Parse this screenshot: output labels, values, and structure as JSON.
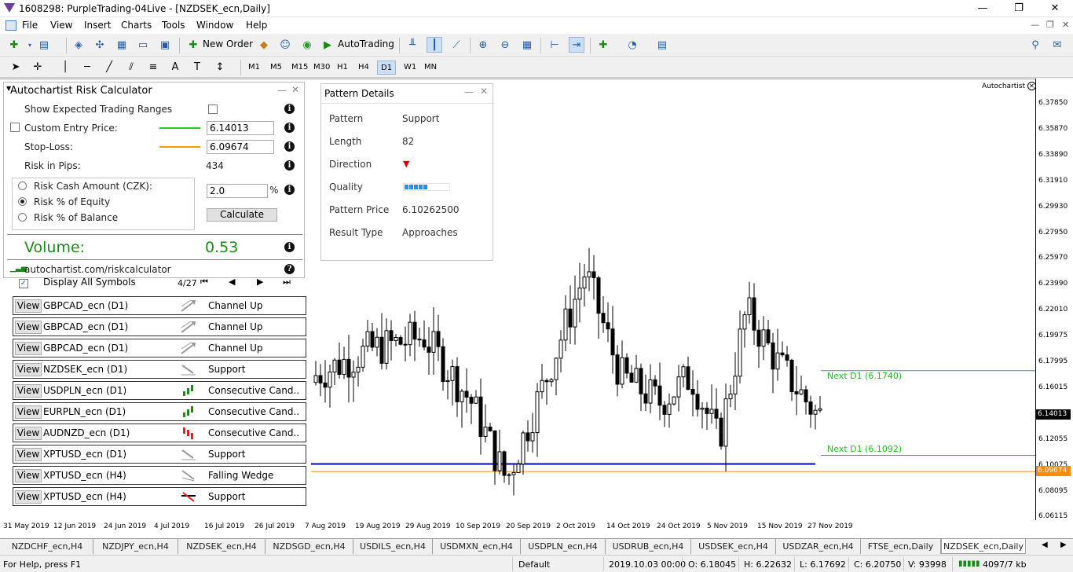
{
  "window": {
    "title": "1608298: PurpleTrading-04Live - [NZDSEK_ecn,Daily]"
  },
  "menu": [
    "File",
    "View",
    "Insert",
    "Charts",
    "Tools",
    "Window",
    "Help"
  ],
  "toolbar": {
    "new_order": "New Order",
    "autotrading": "AutoTrading"
  },
  "timeframes": [
    "M1",
    "M5",
    "M15",
    "M30",
    "H1",
    "H4",
    "D1",
    "W1",
    "MN"
  ],
  "active_timeframe": "D1",
  "chart": {
    "watermark": "Autochartist",
    "price_labels": [
      "6.37850",
      "6.35870",
      "6.33890",
      "6.31910",
      "6.29930",
      "6.27950",
      "6.25970",
      "6.23990",
      "6.22010",
      "6.19975",
      "6.17995",
      "6.16015",
      "6.14013",
      "6.12055",
      "6.10075",
      "6.09674",
      "6.08095",
      "6.06115"
    ],
    "current_price": "6.14013",
    "stop_price": "6.09674",
    "date_labels": [
      "31 May 2019",
      "12 Jun 2019",
      "24 Jun 2019",
      "4 Jul 2019",
      "16 Jul 2019",
      "26 Jul 2019",
      "7 Aug 2019",
      "19 Aug 2019",
      "29 Aug 2019",
      "10 Sep 2019",
      "20 Sep 2019",
      "2 Oct 2019",
      "14 Oct 2019",
      "24 Oct 2019",
      "5 Nov 2019",
      "15 Nov 2019",
      "27 Nov 2019"
    ],
    "next_up": "Next D1 (6.1740)",
    "next_down": "Next D1 (6.1092)",
    "colors": {
      "up": "#000000",
      "down": "#000000",
      "support": "#0000aa",
      "stop": "#ff8c00",
      "next": "#22bb22"
    }
  },
  "risk": {
    "title": "Autochartist Risk Calculator",
    "show_ranges": "Show Expected Trading Ranges",
    "custom_entry": "Custom Entry Price:",
    "entry_value": "6.14013",
    "stop_loss": "Stop-Loss:",
    "stop_value": "6.09674",
    "risk_pips_label": "Risk in Pips:",
    "risk_pips": "434",
    "opt_cash": "Risk Cash Amount (CZK):",
    "opt_equity": "Risk % of Equity",
    "opt_balance": "Risk % of Balance",
    "percent_value": "2.0",
    "percent_sign": "%",
    "calculate": "Calculate",
    "volume_label": "Volume:",
    "volume": "0.53",
    "url": "autochartist.com/riskcalculator"
  },
  "pattern": {
    "title": "Pattern Details",
    "rows": [
      {
        "label": "Pattern",
        "value": "Support"
      },
      {
        "label": "Length",
        "value": "82"
      },
      {
        "label": "Direction",
        "value": ""
      },
      {
        "label": "Quality",
        "value": ""
      },
      {
        "label": "Pattern Price",
        "value": "6.10262500"
      },
      {
        "label": "Result Type",
        "value": "Approaches"
      }
    ],
    "quality_level": 0.5
  },
  "list": {
    "display_all": "Display All Symbols",
    "page": "4/27",
    "view": "View",
    "items": [
      {
        "symbol": "GBPCAD_ecn (D1)",
        "pattern": "Channel Up",
        "icon": "channel-up-icon"
      },
      {
        "symbol": "GBPCAD_ecn (D1)",
        "pattern": "Channel Up",
        "icon": "channel-up-icon"
      },
      {
        "symbol": "GBPCAD_ecn (D1)",
        "pattern": "Channel Up",
        "icon": "channel-up-icon"
      },
      {
        "symbol": "NZDSEK_ecn (D1)",
        "pattern": "Support",
        "icon": "support-icon"
      },
      {
        "symbol": "USDPLN_ecn (D1)",
        "pattern": "Consecutive Cand..",
        "icon": "consecutive-up-icon"
      },
      {
        "symbol": "EURPLN_ecn (D1)",
        "pattern": "Consecutive Cand..",
        "icon": "consecutive-up-icon"
      },
      {
        "symbol": "AUDNZD_ecn (D1)",
        "pattern": "Consecutive Cand..",
        "icon": "consecutive-down-icon"
      },
      {
        "symbol": "XPTUSD_ecn (D1)",
        "pattern": "Support",
        "icon": "support-icon"
      },
      {
        "symbol": "XPTUSD_ecn (H4)",
        "pattern": "Falling Wedge",
        "icon": "falling-wedge-icon"
      },
      {
        "symbol": "XPTUSD_ecn (H4)",
        "pattern": "Support",
        "icon": "support-break-icon"
      }
    ]
  },
  "tabs": [
    "NZDCHF_ecn,H4",
    "NZDJPY_ecn,H4",
    "NZDSEK_ecn,H4",
    "NZDSGD_ecn,H4",
    "USDILS_ecn,H4",
    "USDMXN_ecn,H4",
    "USDPLN_ecn,H4",
    "USDRUB_ecn,H4",
    "USDSEK_ecn,H4",
    "USDZAR_ecn,H4",
    "FTSE_ecn,Daily",
    "NZDSEK_ecn,Daily"
  ],
  "active_tab": "NZDSEK_ecn,Daily",
  "status": {
    "help": "For Help, press F1",
    "profile": "Default",
    "time": "2019.10.03 00:00",
    "open": "O: 6.18045",
    "high": "H: 6.22632",
    "low": "L: 6.17692",
    "close": "C: 6.20750",
    "volume": "V: 93998",
    "traffic": "4097/7 kb"
  }
}
